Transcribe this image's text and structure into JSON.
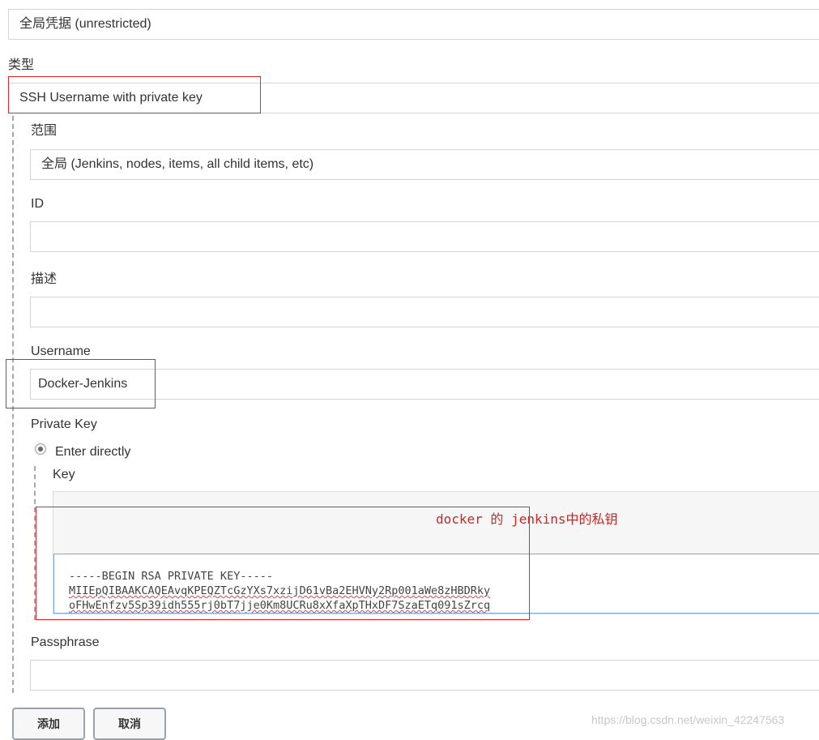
{
  "domain_select": {
    "value": "全局凭据 (unrestricted)"
  },
  "kind": {
    "label": "类型",
    "value": "SSH Username with private key"
  },
  "scope": {
    "label": "范围",
    "value": "全局 (Jenkins, nodes, items, all child items, etc)"
  },
  "id_field": {
    "label": "ID",
    "value": ""
  },
  "description": {
    "label": "描述",
    "value": ""
  },
  "username": {
    "label": "Username",
    "value": "Docker-Jenkins"
  },
  "private_key": {
    "label": "Private Key",
    "option_label": "Enter directly",
    "key_label": "Key",
    "annotation": "docker 的 jenkins中的私钥",
    "key_lines": [
      "-----BEGIN RSA PRIVATE KEY-----",
      "MIIEpQIBAAKCAQEAvqKPEQZTcGzYXs7xzijD61vBa2EHVNy2Rp001aWe8zHBDRky",
      "oFHwEnfzv5Sp39idh555rj0bT7jje0Km8UCRu8xXfaXpTHxDF7SzaETq091sZrcq"
    ]
  },
  "passphrase": {
    "label": "Passphrase",
    "value": ""
  },
  "buttons": {
    "add": "添加",
    "cancel": "取消"
  },
  "watermark": "https://blog.csdn.net/weixin_42247563",
  "colors": {
    "highlight": "#e8232a",
    "annotation": "#c62828"
  }
}
